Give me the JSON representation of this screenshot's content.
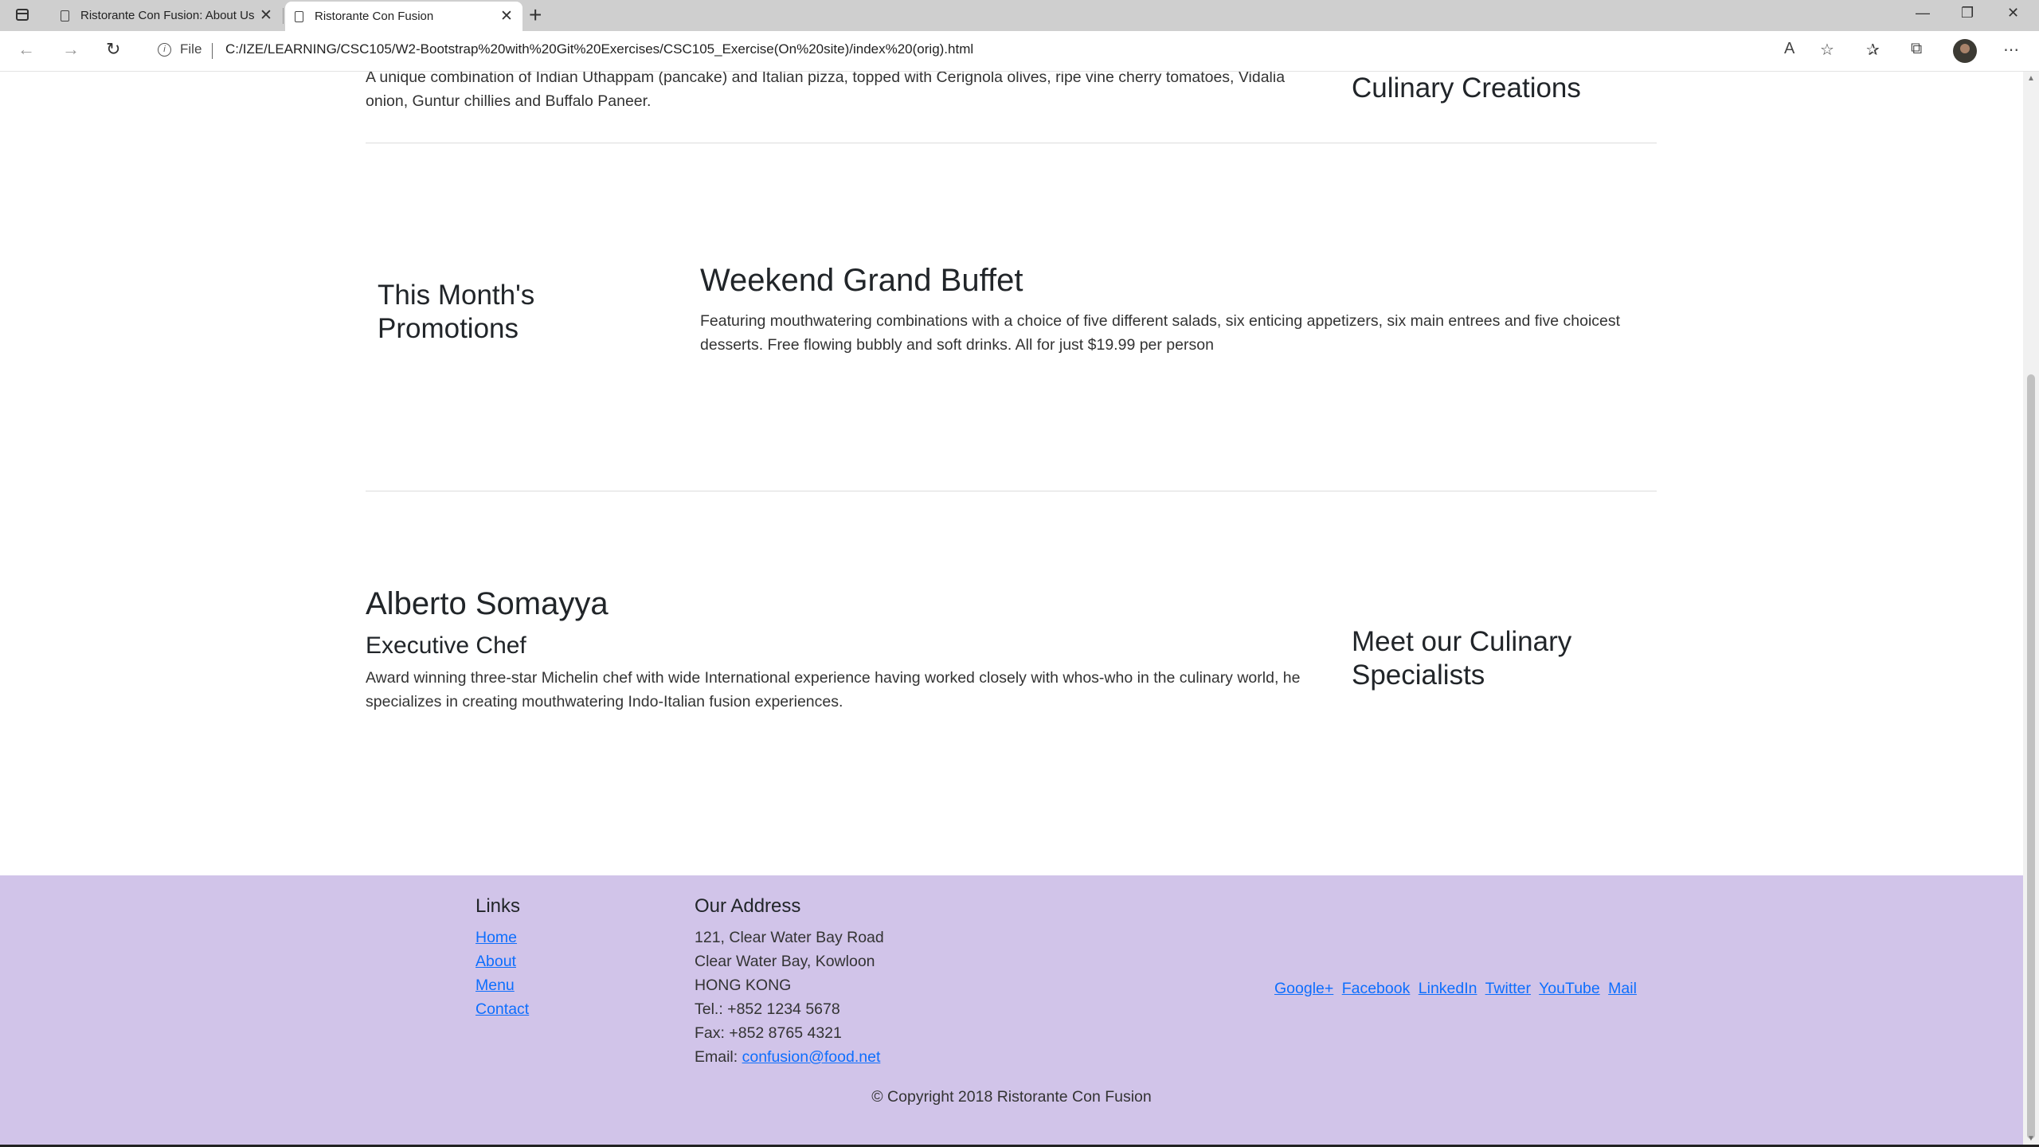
{
  "browser": {
    "tabs": [
      {
        "title": "Ristorante Con Fusion: About Us",
        "close": "✕"
      },
      {
        "title": "Ristorante Con Fusion",
        "close": "✕"
      }
    ],
    "new_tab": "+",
    "window_controls": {
      "minimize": "—",
      "restore": "❐",
      "close": "✕"
    },
    "address": {
      "scheme_label": "File",
      "url": "C:/IZE/LEARNING/CSC105/W2-Bootstrap%20with%20Git%20Exercises/CSC105_Exercise(On%20site)/index%20(orig).html"
    },
    "nav": {
      "back": "←",
      "forward": "→",
      "reload": "↻"
    },
    "toolbar": {
      "read_aloud": "A",
      "favorite": "☆",
      "favorites": "✰",
      "collections": "⧉",
      "more": "⋯"
    }
  },
  "page": {
    "dish": {
      "description": "A unique combination of Indian Uthappam (pancake) and Italian pizza, topped with Cerignola olives, ripe vine cherry tomatoes, Vidalia onion, Guntur chillies and Buffalo Paneer.",
      "section_heading": "Culinary Creations"
    },
    "promotion": {
      "section_heading": "This Month's Promotions",
      "title": "Weekend Grand Buffet",
      "description": "Featuring mouthwatering combinations with a choice of five different salads, six enticing appetizers, six main entrees and five choicest desserts. Free flowing bubbly and soft drinks. All for just $19.99 per person"
    },
    "leader": {
      "name": "Alberto Somayya",
      "designation": "Executive Chef",
      "description": "Award winning three-star Michelin chef with wide International experience having worked closely with whos-who in the culinary world, he specializes in creating mouthwatering Indo-Italian fusion experiences.",
      "section_heading": "Meet our Culinary Specialists"
    }
  },
  "footer": {
    "links_heading": "Links",
    "links": [
      "Home",
      "About",
      "Menu",
      "Contact"
    ],
    "address_heading": "Our Address",
    "address_lines": [
      "121, Clear Water Bay Road",
      "Clear Water Bay, Kowloon",
      "HONG KONG",
      "Tel.: +852 1234 5678",
      "Fax: +852 8765 4321"
    ],
    "email_label": "Email: ",
    "email": "confusion@food.net",
    "social": [
      "Google+",
      "Facebook",
      "LinkedIn",
      "Twitter",
      "YouTube",
      "Mail"
    ],
    "copyright": "© Copyright 2018 Ristorante Con Fusion"
  },
  "colors": {
    "footer_bg": "#d1c4e9",
    "link": "#0d6efd"
  }
}
